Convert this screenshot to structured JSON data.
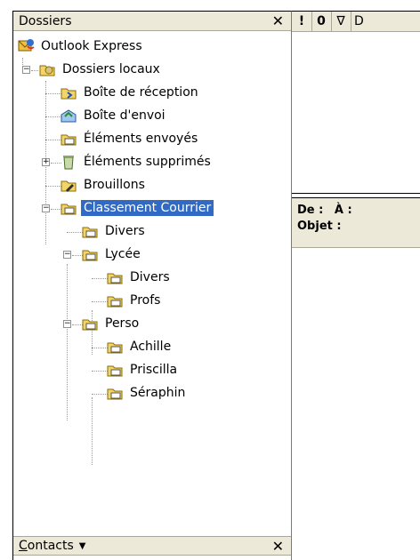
{
  "folders_pane": {
    "title": "Dossiers",
    "close_glyph": "✕",
    "root": "Outlook Express",
    "local_folders": "Dossiers locaux",
    "inbox": "Boîte de réception",
    "outbox": "Boîte d'envoi",
    "sent": "Éléments envoyés",
    "deleted": "Éléments supprimés",
    "drafts": "Brouillons",
    "classement": "Classement Courrier",
    "divers": "Divers",
    "lycee": "Lycée",
    "lycee_divers": "Divers",
    "lycee_profs": "Profs",
    "perso": "Perso",
    "perso_achille": "Achille",
    "perso_priscilla": "Priscilla",
    "perso_seraphin": "Séraphin"
  },
  "contacts_pane": {
    "title_first": "C",
    "title_rest": "ontacts",
    "dropdown_glyph": "▼",
    "close_glyph": "✕"
  },
  "message_list": {
    "columns": {
      "priority": "!",
      "attachment": "0",
      "flag": "∇",
      "from": "D"
    }
  },
  "preview_pane": {
    "from_label": "De :",
    "to_label": "À :",
    "subject_label": "Objet :"
  }
}
